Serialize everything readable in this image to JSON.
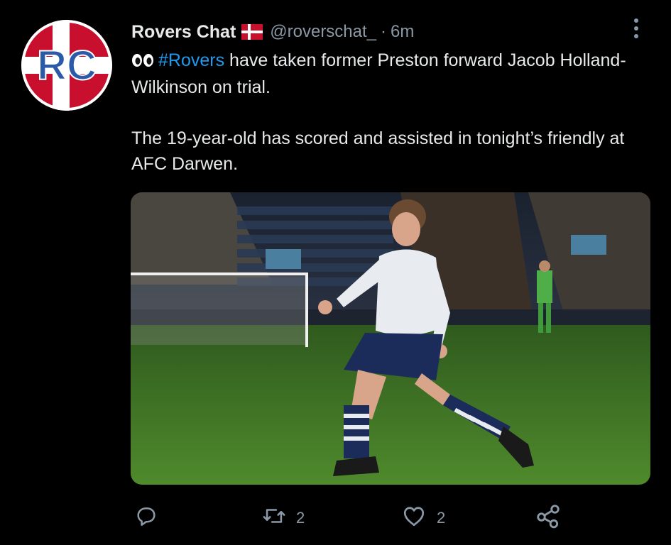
{
  "tweet": {
    "display_name": "Rovers Chat",
    "flag_icon": "denmark-flag-icon",
    "handle": "@roverschat_",
    "separator": "·",
    "time": "6m",
    "avatar_text": "RC",
    "emoji": "eyes-emoji",
    "hashtag": "#Rovers",
    "text_line1_rest": " have taken former Preston forward Jacob Holland-Wilkinson on trial.",
    "paragraph2": "The 19-year-old has scored and assisted in tonight’s friendly at AFC Darwen."
  },
  "actions": {
    "reply_icon": "reply-icon",
    "retweet_icon": "retweet-icon",
    "retweet_count": "2",
    "like_icon": "heart-icon",
    "like_count": "2",
    "share_icon": "share-icon"
  },
  "colors": {
    "background": "#000000",
    "text": "#e7e9ea",
    "muted": "#8b98a5",
    "link": "#1d9bf0"
  }
}
